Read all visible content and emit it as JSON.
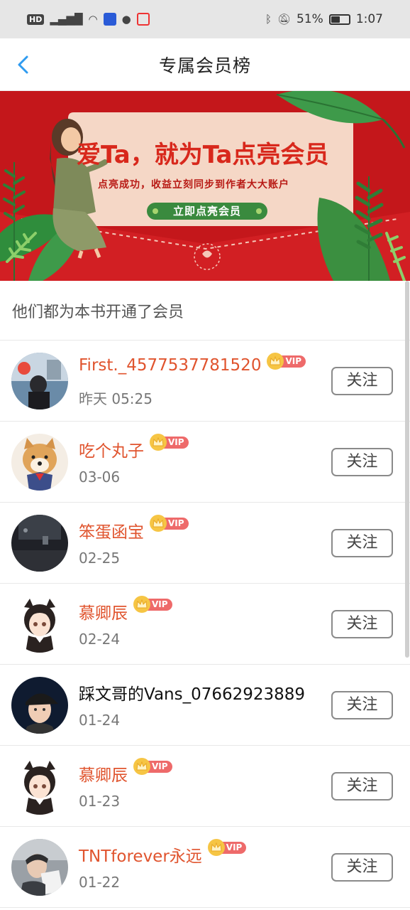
{
  "status_bar": {
    "network_tag": "HD",
    "signal": "5G",
    "battery_percent": "51%",
    "battery_level": 0.51,
    "time": "1:07"
  },
  "nav": {
    "back_icon": "chevron-left-icon",
    "title": "专属会员榜"
  },
  "banner": {
    "headline": "爱Ta，就为Ta点亮会员",
    "subtitle": "点亮成功，收益立刻同步到作者大大账户",
    "button_label": "立即点亮会员"
  },
  "section": {
    "title": "他们都为本书开通了会员"
  },
  "members": [
    {
      "name": "First._4577537781520",
      "date": "昨天 05:25",
      "vip": true,
      "vip_label": "VIP",
      "follow_label": "关注",
      "avatar": "avatar-photo-dark"
    },
    {
      "name": "吃个丸子",
      "date": "03-06",
      "vip": true,
      "vip_label": "VIP",
      "follow_label": "关注",
      "avatar": "avatar-shiba-dog"
    },
    {
      "name": "笨蛋函宝",
      "date": "02-25",
      "vip": true,
      "vip_label": "VIP",
      "follow_label": "关注",
      "avatar": "avatar-dark-scene"
    },
    {
      "name": "慕卿辰",
      "date": "02-24",
      "vip": true,
      "vip_label": "VIP",
      "follow_label": "关注",
      "avatar": "avatar-anime-girl"
    },
    {
      "name": "踩文哥的Vans_07662923889",
      "date": "01-24",
      "vip": false,
      "vip_label": "",
      "follow_label": "关注",
      "avatar": "avatar-boy-cap"
    },
    {
      "name": "慕卿辰",
      "date": "01-23",
      "vip": true,
      "vip_label": "VIP",
      "follow_label": "关注",
      "avatar": "avatar-anime-girl"
    },
    {
      "name": "TNTforever永远",
      "date": "01-22",
      "vip": true,
      "vip_label": "VIP",
      "follow_label": "关注",
      "avatar": "avatar-boy-gray"
    }
  ],
  "colors": {
    "accent_name": "#e0542e",
    "banner_red": "#c4171b",
    "back_blue": "#2f9bf0",
    "vip_gold": "#f6c544",
    "vip_red": "#ee6a6a"
  }
}
